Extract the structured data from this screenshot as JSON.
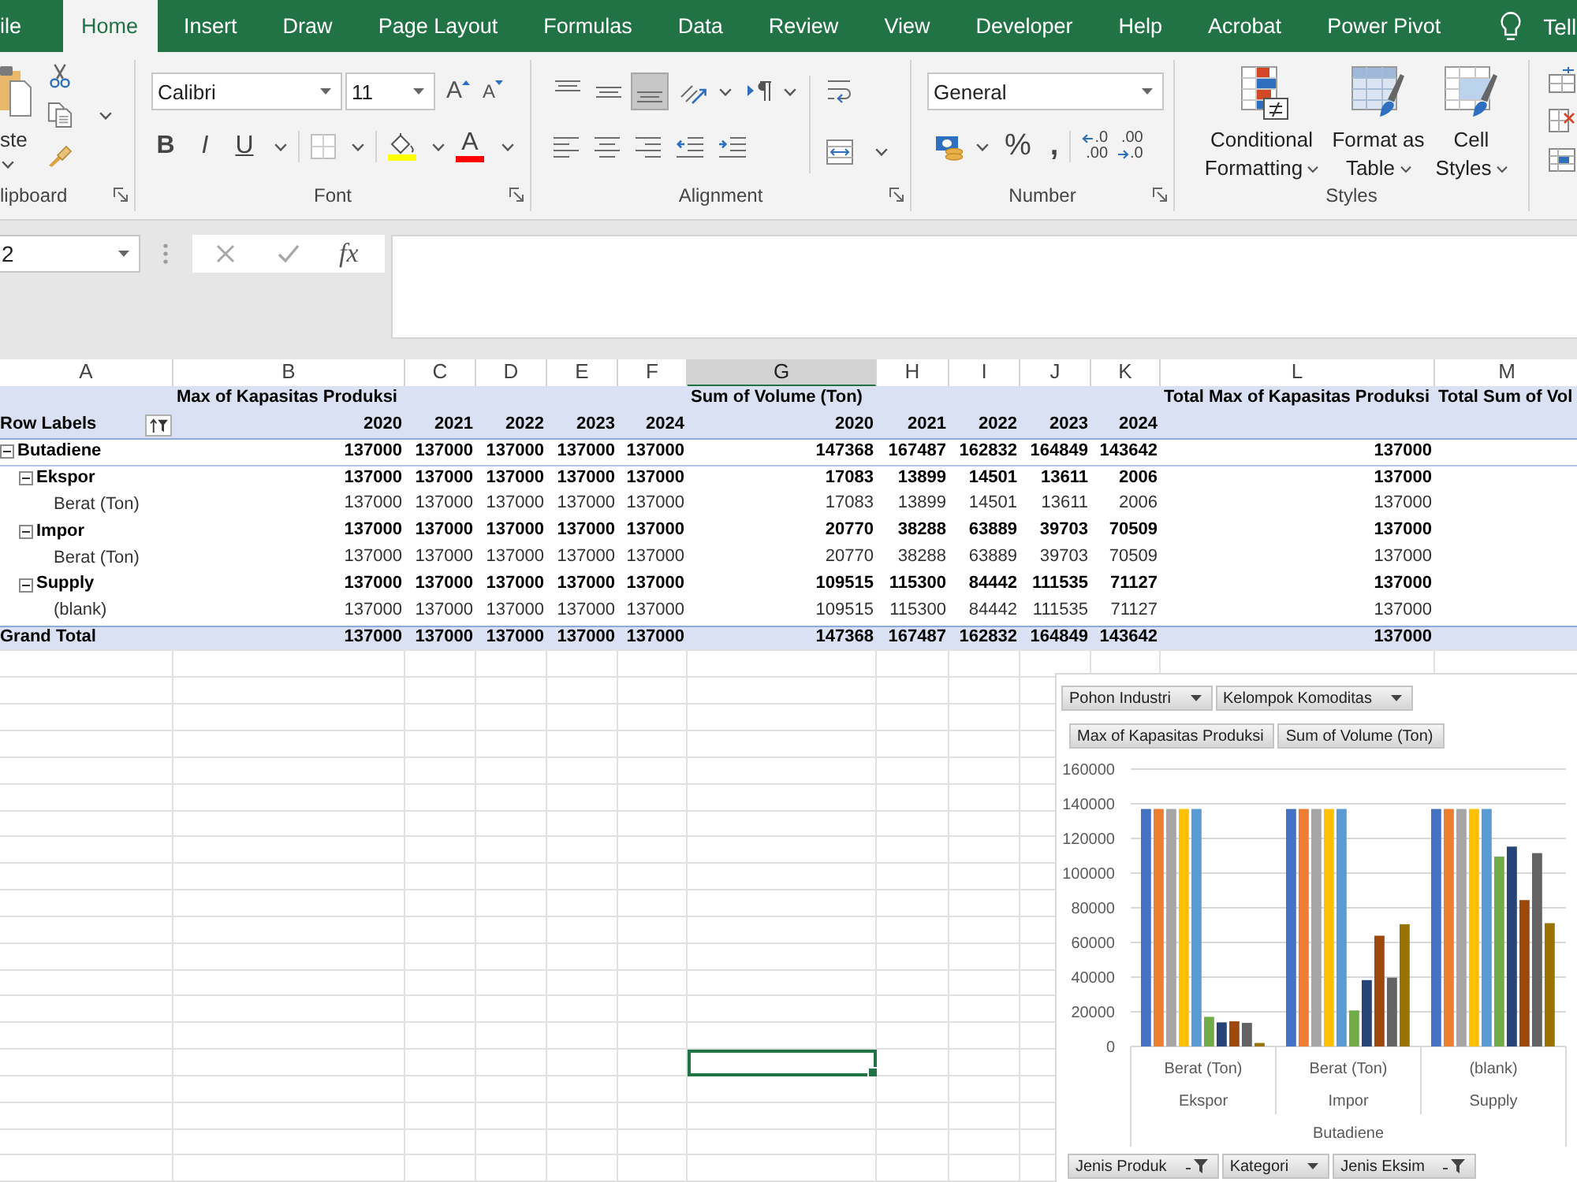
{
  "tabs": [
    {
      "label": "ile",
      "selected": false
    },
    {
      "label": "Home",
      "selected": true
    },
    {
      "label": "Insert",
      "selected": false
    },
    {
      "label": "Draw",
      "selected": false
    },
    {
      "label": "Page Layout",
      "selected": false
    },
    {
      "label": "Formulas",
      "selected": false
    },
    {
      "label": "Data",
      "selected": false
    },
    {
      "label": "Review",
      "selected": false
    },
    {
      "label": "View",
      "selected": false
    },
    {
      "label": "Developer",
      "selected": false
    },
    {
      "label": "Help",
      "selected": false
    },
    {
      "label": "Acrobat",
      "selected": false
    },
    {
      "label": "Power Pivot",
      "selected": false
    }
  ],
  "tell_me": "Tell",
  "ribbon": {
    "clipboard": {
      "paste_label": "ste",
      "label": "lipboard"
    },
    "font": {
      "name": "Calibri",
      "size": "11",
      "grow_glyph": "A",
      "shrink_glyph": "A",
      "styles": [
        {
          "kind": "bold",
          "glyph": "B"
        },
        {
          "kind": "italic",
          "glyph": "I"
        },
        {
          "kind": "underline",
          "glyph": "U"
        }
      ],
      "font_color_glyph": "A",
      "label": "Font"
    },
    "alignment": {
      "vertical": [
        {
          "kind": "top",
          "selected": false
        },
        {
          "kind": "middle",
          "selected": false
        },
        {
          "kind": "bottom",
          "selected": true
        }
      ],
      "label": "Alignment"
    },
    "number": {
      "format": "General",
      "percent": "%",
      "comma": ",",
      "decimals": [
        {
          "kind": "increase",
          "top": ".0",
          "bottom": ".00"
        },
        {
          "kind": "decrease",
          "top": ".00",
          "bottom": ".0"
        }
      ],
      "label": "Number"
    },
    "styles": {
      "buttons": [
        {
          "kind": "conditional",
          "lines": [
            "Conditional",
            "Formatting"
          ]
        },
        {
          "kind": "table",
          "lines": [
            "Format as",
            "Table"
          ]
        },
        {
          "kind": "cell",
          "lines": [
            "Cell",
            "Styles"
          ]
        }
      ],
      "label": "Styles"
    }
  },
  "formula_bar": {
    "name_box": "2",
    "fx": "fx"
  },
  "sheet": {
    "columns": [
      {
        "label": "A",
        "selected": false
      },
      {
        "label": "B",
        "selected": false
      },
      {
        "label": "C",
        "selected": false
      },
      {
        "label": "D",
        "selected": false
      },
      {
        "label": "E",
        "selected": false
      },
      {
        "label": "F",
        "selected": false
      },
      {
        "label": "G",
        "selected": true
      },
      {
        "label": "H",
        "selected": false
      },
      {
        "label": "I",
        "selected": false
      },
      {
        "label": "J",
        "selected": false
      },
      {
        "label": "K",
        "selected": false
      },
      {
        "label": "L",
        "selected": false
      },
      {
        "label": "M",
        "selected": false
      }
    ],
    "pivot": {
      "value_fields": [
        "Max of Kapasitas Produksi",
        "Sum of Volume (Ton)"
      ],
      "total_headers": [
        "Total Max of Kapasitas Produksi",
        "Total Sum of Vol"
      ],
      "row_labels": {
        "label": "Row Labels",
        "filtered": true
      },
      "years": [
        "2020",
        "2021",
        "2022",
        "2023",
        "2024",
        "2020",
        "2021",
        "2022",
        "2023",
        "2024"
      ],
      "rows": [
        {
          "label": "Butadiene",
          "expanded": true,
          "values": [
            "137000",
            "137000",
            "137000",
            "137000",
            "137000",
            "147368",
            "167487",
            "162832",
            "164849",
            "143642"
          ],
          "total": "137000",
          "children": [
            {
              "label": "Ekspor",
              "expanded": true,
              "values": [
                "137000",
                "137000",
                "137000",
                "137000",
                "137000",
                "17083",
                "13899",
                "14501",
                "13611",
                "2006"
              ],
              "total": "137000",
              "children": [
                {
                  "label": "Berat (Ton)",
                  "values": [
                    "137000",
                    "137000",
                    "137000",
                    "137000",
                    "137000",
                    "17083",
                    "13899",
                    "14501",
                    "13611",
                    "2006"
                  ],
                  "total": "137000"
                }
              ]
            },
            {
              "label": "Impor",
              "expanded": true,
              "values": [
                "137000",
                "137000",
                "137000",
                "137000",
                "137000",
                "20770",
                "38288",
                "63889",
                "39703",
                "70509"
              ],
              "total": "137000",
              "children": [
                {
                  "label": "Berat (Ton)",
                  "values": [
                    "137000",
                    "137000",
                    "137000",
                    "137000",
                    "137000",
                    "20770",
                    "38288",
                    "63889",
                    "39703",
                    "70509"
                  ],
                  "total": "137000"
                }
              ]
            },
            {
              "label": "Supply",
              "expanded": true,
              "values": [
                "137000",
                "137000",
                "137000",
                "137000",
                "137000",
                "109515",
                "115300",
                "84442",
                "111535",
                "71127"
              ],
              "total": "137000",
              "children": [
                {
                  "label": "(blank)",
                  "values": [
                    "137000",
                    "137000",
                    "137000",
                    "137000",
                    "137000",
                    "109515",
                    "115300",
                    "84442",
                    "111535",
                    "71127"
                  ],
                  "total": "137000"
                }
              ]
            }
          ]
        }
      ],
      "grand_total": {
        "label": "Grand Total",
        "values": [
          "137000",
          "137000",
          "137000",
          "137000",
          "137000",
          "147368",
          "167487",
          "162832",
          "164849",
          "143642"
        ],
        "total": "137000"
      }
    },
    "blank_rows": [
      {
        "selected": false
      },
      {
        "selected": false
      },
      {
        "selected": false
      },
      {
        "selected": false
      },
      {
        "selected": false
      },
      {
        "selected": false
      },
      {
        "selected": false
      },
      {
        "selected": false
      },
      {
        "selected": false
      },
      {
        "selected": false
      },
      {
        "selected": false
      },
      {
        "selected": false
      },
      {
        "selected": false
      },
      {
        "selected": false
      },
      {
        "selected": false
      },
      {
        "selected": true
      },
      {
        "selected": false
      },
      {
        "selected": false
      },
      {
        "selected": false
      },
      {
        "selected": false
      }
    ]
  },
  "pivot_chart": {
    "filter_fields": [
      {
        "label": "Pohon Industri",
        "filtered": false
      },
      {
        "label": "Kelompok Komoditas",
        "filtered": false
      }
    ],
    "value_fields": [
      "Max of Kapasitas Produksi",
      "Sum of Volume (Ton)"
    ],
    "category_groups": [
      [
        "Ekspor",
        "Impor",
        "Supply"
      ],
      [
        "Butadiene"
      ]
    ],
    "axis_fields": [
      {
        "label": "Jenis Produk",
        "filtered": true
      },
      {
        "label": "Kategori",
        "filtered": false
      },
      {
        "label": "Jenis Eksim",
        "filtered": true
      }
    ],
    "chart_data": [
      {
        "type": "bar",
        "categories": [
          "Berat (Ton)",
          "Berat (Ton)",
          "(blank)"
        ],
        "ylim": [
          0,
          160000
        ],
        "yticks": [
          0,
          20000,
          40000,
          60000,
          80000,
          100000,
          120000,
          140000,
          160000
        ],
        "grid": true,
        "series": [
          {
            "color": "#4472c4",
            "values": [
              137000,
              137000,
              137000
            ]
          },
          {
            "color": "#ed7d31",
            "values": [
              137000,
              137000,
              137000
            ]
          },
          {
            "color": "#a5a5a5",
            "values": [
              137000,
              137000,
              137000
            ]
          },
          {
            "color": "#ffc000",
            "values": [
              137000,
              137000,
              137000
            ]
          },
          {
            "color": "#5b9bd5",
            "values": [
              137000,
              137000,
              137000
            ]
          },
          {
            "color": "#70ad47",
            "values": [
              17083,
              20770,
              109515
            ]
          },
          {
            "color": "#264478",
            "values": [
              13899,
              38288,
              115300
            ]
          },
          {
            "color": "#9e480e",
            "values": [
              14501,
              63889,
              84442
            ]
          },
          {
            "color": "#636363",
            "values": [
              13611,
              39703,
              111535
            ]
          },
          {
            "color": "#997300",
            "values": [
              2006,
              70509,
              71127
            ]
          }
        ]
      }
    ]
  }
}
